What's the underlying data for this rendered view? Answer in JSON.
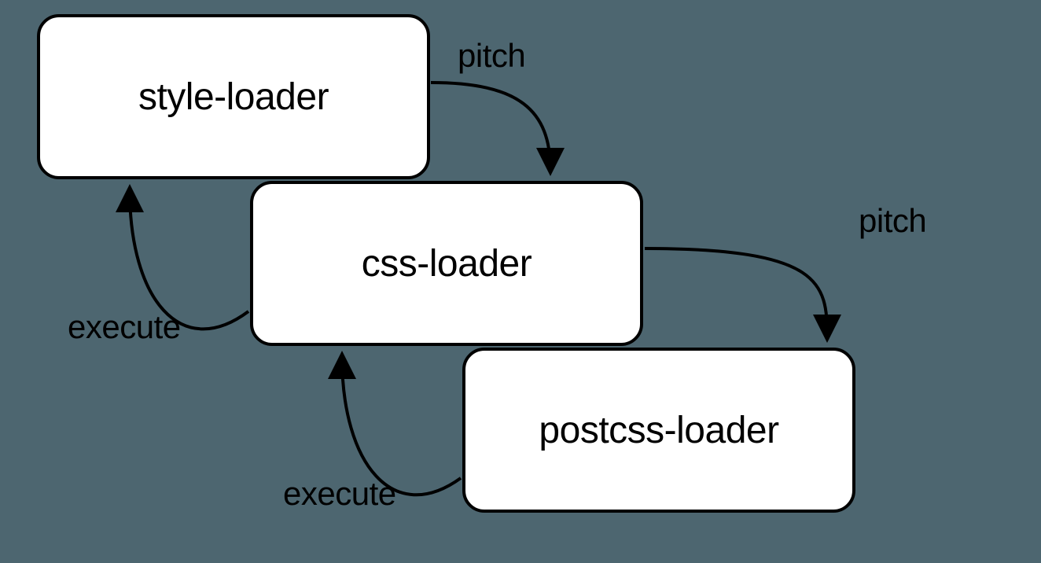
{
  "nodes": {
    "style_loader": {
      "label": "style-loader"
    },
    "css_loader": {
      "label": "css-loader"
    },
    "postcss_loader": {
      "label": "postcss-loader"
    }
  },
  "edges": {
    "pitch1": {
      "label": "pitch"
    },
    "pitch2": {
      "label": "pitch"
    },
    "execute1": {
      "label": "execute"
    },
    "execute2": {
      "label": "execute"
    }
  }
}
